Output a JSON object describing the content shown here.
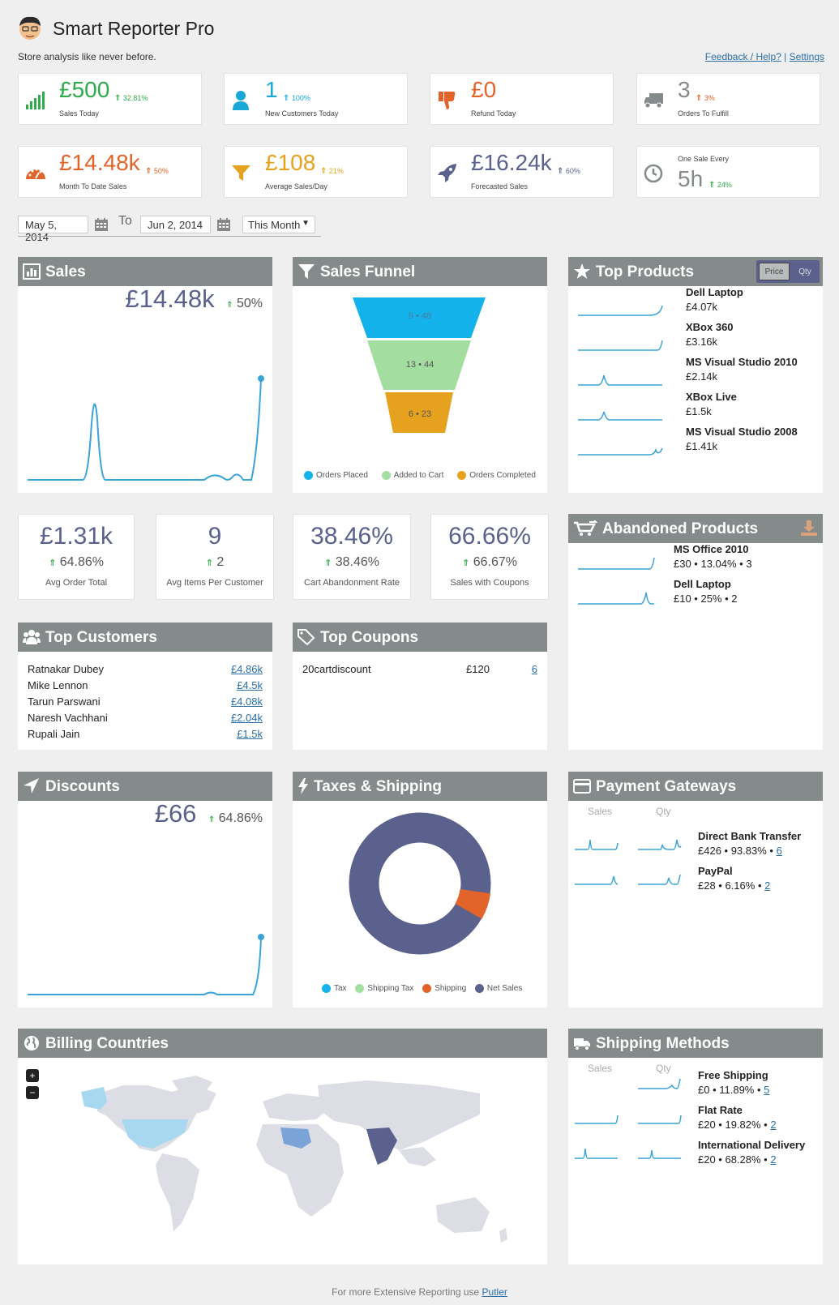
{
  "app": {
    "title": "Smart Reporter Pro",
    "tagline": "Store analysis like never before.",
    "links": {
      "feedback": "Feedback / Help?",
      "sep": "|",
      "settings": "Settings"
    }
  },
  "kpis": [
    {
      "value": "£500",
      "change": "32.81%",
      "label": "Sales Today",
      "color": "#2eab4b",
      "icon": "signal-bars-icon"
    },
    {
      "value": "1",
      "change": "100%",
      "label": "New Customers Today",
      "color": "#17a8d8",
      "icon": "user-icon"
    },
    {
      "value": "£0",
      "change": "",
      "label": "Refund Today",
      "color": "#e2642a",
      "icon": "thumbs-down-icon"
    },
    {
      "value": "3",
      "change": "3%",
      "label": "Orders To Fulfill",
      "color": "#858b8b",
      "icon": "truck-icon"
    },
    {
      "value": "£14.48k",
      "change": "50%",
      "label": "Month To Date Sales",
      "color": "#e2642a",
      "icon": "gauge-icon"
    },
    {
      "value": "£108",
      "change": "21%",
      "label": "Average Sales/Day",
      "color": "#e6a21f",
      "icon": "funnel-icon"
    },
    {
      "value": "£16.24k",
      "change": "60%",
      "label": "Forecasted Sales",
      "color": "#5a618d",
      "icon": "rocket-icon"
    },
    {
      "value": "5h",
      "change": "24%",
      "label": "One Sale Every",
      "color": "#858b8b",
      "icon": "clock-icon"
    }
  ],
  "daterange": {
    "from": "May 5, 2014",
    "to_label": "To",
    "to": "Jun 2, 2014",
    "preset": "This Month"
  },
  "sales": {
    "title": "Sales",
    "value": "£14.48k",
    "change": "50%"
  },
  "funnel": {
    "title": "Sales Funnel",
    "stages": [
      {
        "label": "9 • 48",
        "color": "#14b2ea"
      },
      {
        "label": "13 • 44",
        "color": "#a3dea0"
      },
      {
        "label": "6 • 23",
        "color": "#e6a21f"
      }
    ],
    "legend": [
      "Orders Placed",
      "Added to Cart",
      "Orders Completed"
    ]
  },
  "top_products": {
    "title": "Top Products",
    "toggle": [
      "Price",
      "Qty"
    ],
    "items": [
      {
        "name": "Dell Laptop",
        "value": "£4.07k"
      },
      {
        "name": "XBox 360",
        "value": "£3.16k"
      },
      {
        "name": "MS Visual Studio 2010",
        "value": "£2.14k"
      },
      {
        "name": "XBox Live",
        "value": "£1.5k"
      },
      {
        "name": "MS Visual Studio 2008",
        "value": "£1.41k"
      }
    ]
  },
  "stats": [
    {
      "value": "£1.31k",
      "change": "64.86%",
      "label": "Avg Order Total"
    },
    {
      "value": "9",
      "change": "2",
      "label": "Avg Items Per Customer"
    },
    {
      "value": "38.46%",
      "change": "38.46%",
      "label": "Cart Abandonment Rate"
    },
    {
      "value": "66.66%",
      "change": "66.67%",
      "label": "Sales with Coupons"
    }
  ],
  "abandoned": {
    "title": "Abandoned Products",
    "items": [
      {
        "name": "MS Office 2010",
        "detail": "£30 • 13.04% • 3"
      },
      {
        "name": "Dell Laptop",
        "detail": "£10 • 25% • 2"
      }
    ]
  },
  "top_customers": {
    "title": "Top Customers",
    "rows": [
      {
        "name": "Ratnakar Dubey",
        "value": "£4.86k"
      },
      {
        "name": "Mike Lennon",
        "value": "£4.5k"
      },
      {
        "name": "Tarun Parswani",
        "value": "£4.08k"
      },
      {
        "name": "Naresh Vachhani",
        "value": "£2.04k"
      },
      {
        "name": "Rupali Jain",
        "value": "£1.5k"
      }
    ]
  },
  "top_coupons": {
    "title": "Top Coupons",
    "rows": [
      {
        "code": "20cartdiscount",
        "amount": "£120",
        "count": "6"
      }
    ]
  },
  "discounts": {
    "title": "Discounts",
    "value": "£66",
    "change": "64.86%"
  },
  "taxes": {
    "title": "Taxes & Shipping",
    "legend": [
      {
        "name": "Tax",
        "color": "#14b2ea"
      },
      {
        "name": "Shipping Tax",
        "color": "#a3dea0"
      },
      {
        "name": "Shipping",
        "color": "#e2642a"
      },
      {
        "name": "Net Sales",
        "color": "#5a618d"
      }
    ]
  },
  "payment": {
    "title": "Payment Gateways",
    "cols": [
      "Sales",
      "Qty"
    ],
    "items": [
      {
        "name": "Direct Bank Transfer",
        "detail": "£426 • 93.83% • ",
        "count": "6"
      },
      {
        "name": "PayPal",
        "detail": "£28 • 6.16% • ",
        "count": "2"
      }
    ]
  },
  "billing": {
    "title": "Billing Countries",
    "zoom_in": "+",
    "zoom_out": "−"
  },
  "shipping": {
    "title": "Shipping Methods",
    "cols": [
      "Sales",
      "Qty"
    ],
    "items": [
      {
        "name": "Free Shipping",
        "detail": "£0 • 11.89% • ",
        "count": "5"
      },
      {
        "name": "Flat Rate",
        "detail": "£20 • 19.82% • ",
        "count": "2"
      },
      {
        "name": "International Delivery",
        "detail": "£20 • 68.28% • ",
        "count": "2"
      }
    ]
  },
  "footer": {
    "text": "For more Extensive Reporting use ",
    "link": "Putler"
  }
}
